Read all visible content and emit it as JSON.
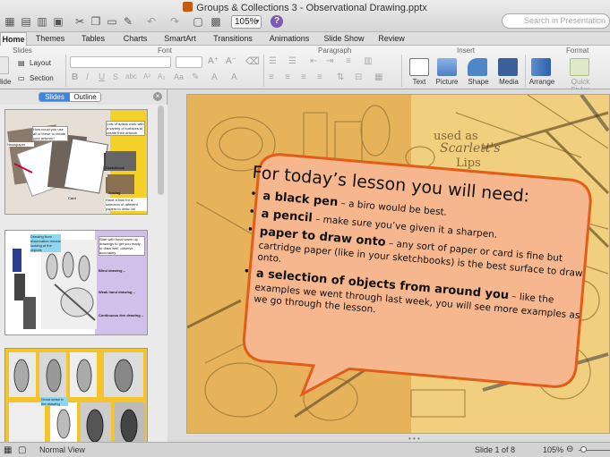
{
  "window": {
    "title": "Groups & Collections 3 - Observational Drawing.pptx",
    "zoom": "105%",
    "search_placeholder": "Search in Presentation"
  },
  "ribbon_tabs": [
    "Home",
    "Themes",
    "Tables",
    "Charts",
    "SmartArt",
    "Transitions",
    "Animations",
    "Slide Show",
    "Review"
  ],
  "ribbon_groups": {
    "slides": "Slides",
    "font": "Font",
    "paragraph": "Paragraph",
    "insert": "Insert",
    "format": "Format"
  },
  "ribbon_buttons": {
    "new_slide": "lide",
    "layout": "Layout",
    "section": "Section",
    "text": "Text",
    "picture": "Picture",
    "shape": "Shape",
    "media": "Media",
    "arrange": "Arrange",
    "quick_styles": "Quick Styles"
  },
  "left_panel": {
    "tabs": [
      "Slides",
      "Outline"
    ],
    "thumb1": {
      "note1": "Lots of artists work with a variety of surfaces to create their artwork.",
      "note2": "How could you use all of these to create your artwork?",
      "note3": "Have a look for a selection of different papers to draw on!",
      "labels": [
        "Newspaper",
        "Card",
        "Sketchbook",
        "Tracing"
      ]
    },
    "thumb2": {
      "note_left": "Drawing from observation means looking at the objects",
      "note_mid": "Start with tonal warm up drawings to get you ready to draw well, observe accurately.",
      "bullets": [
        "Blind drawing –",
        "Weak hand drawing –",
        "Continuous line drawing –"
      ]
    },
    "thumb3": {
      "note": "Great detail in the drawing"
    }
  },
  "slide": {
    "heading": "For today’s lesson you will need:",
    "items": [
      {
        "bold": "a black pen",
        "rest": " – a biro would be best."
      },
      {
        "bold": "a pencil",
        "rest": " – make sure you’ve given it a sharpen."
      },
      {
        "bold": "paper to draw onto",
        "rest": " – any sort of paper or card is fine but cartridge paper (like in your sketchbooks) is the best surface to draw onto."
      },
      {
        "bold": "a selection of objects from around you",
        "rest": " – like the examples we went through last week, you will see more examples as we go through the lesson."
      }
    ],
    "background_text": [
      "used as",
      "Scarlett's",
      "Lips"
    ]
  },
  "status": {
    "view": "Normal View",
    "slide_pos": "Slide 1 of 8",
    "zoom": "105%"
  },
  "colors": {
    "callout_fill": "#f6b78e",
    "callout_stroke": "#e35d1a",
    "slide_bg": "#e9b85e",
    "accent_blue": "#3d86e0"
  }
}
